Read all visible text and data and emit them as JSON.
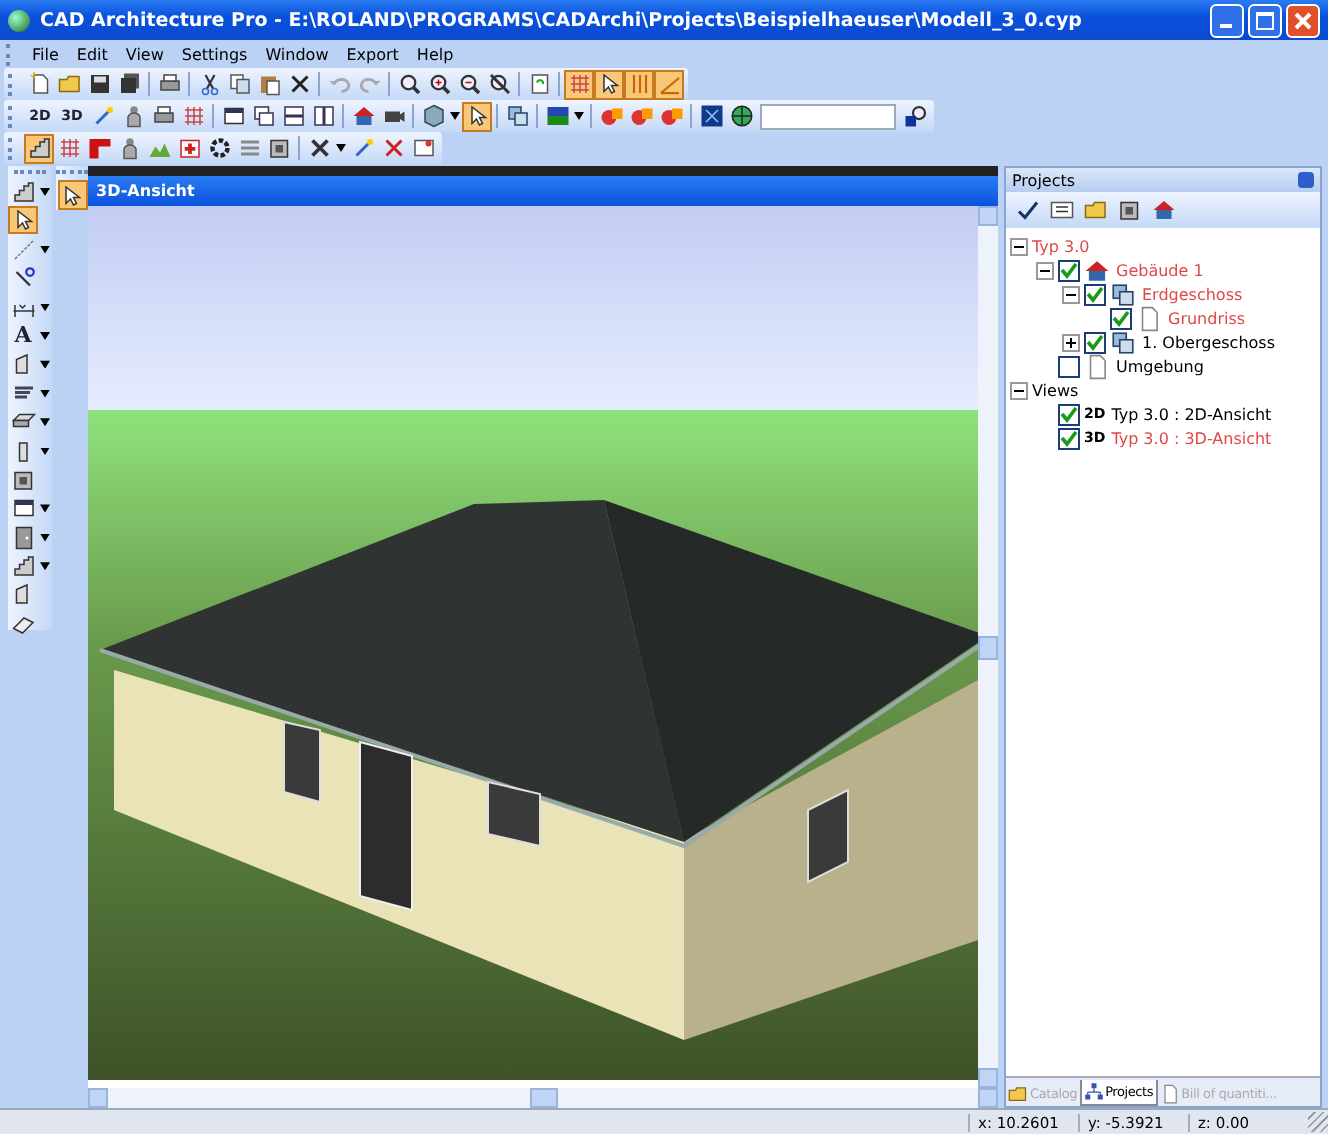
{
  "window": {
    "title": "CAD Architecture Pro - E:\\ROLAND\\PROGRAMS\\CADArchi\\Projects\\Beispielhaeuser\\Modell_3_0.cyp"
  },
  "menu": [
    "File",
    "Edit",
    "View",
    "Settings",
    "Window",
    "Export",
    "Help"
  ],
  "toolbars": [
    [
      {
        "kind": "new",
        "on": false
      },
      {
        "kind": "open",
        "on": false
      },
      {
        "kind": "save",
        "on": false
      },
      {
        "kind": "saveall",
        "on": false
      },
      {
        "kind": "sep"
      },
      {
        "kind": "print",
        "on": false
      },
      {
        "kind": "sep"
      },
      {
        "kind": "cut",
        "on": false
      },
      {
        "kind": "copy",
        "on": false
      },
      {
        "kind": "paste",
        "on": false
      },
      {
        "kind": "delete",
        "on": false
      },
      {
        "kind": "sep"
      },
      {
        "kind": "undo",
        "on": false
      },
      {
        "kind": "redo",
        "on": false
      },
      {
        "kind": "sep"
      },
      {
        "kind": "zoom",
        "on": false
      },
      {
        "kind": "zoomin",
        "on": false
      },
      {
        "kind": "zoomout",
        "on": false
      },
      {
        "kind": "zoomfit",
        "on": false
      },
      {
        "kind": "sep"
      },
      {
        "kind": "refresh",
        "on": false
      },
      {
        "kind": "sep"
      },
      {
        "kind": "grid",
        "on": true
      },
      {
        "kind": "cursor",
        "on": true
      },
      {
        "kind": "lines",
        "on": true
      },
      {
        "kind": "angle",
        "on": true
      }
    ],
    [
      {
        "kind": "text",
        "label": "2D",
        "on": false
      },
      {
        "kind": "text",
        "label": "3D",
        "on": false
      },
      {
        "kind": "wand",
        "on": false
      },
      {
        "kind": "person",
        "on": false
      },
      {
        "kind": "print",
        "on": false
      },
      {
        "kind": "grid",
        "on": false
      },
      {
        "kind": "sep"
      },
      {
        "kind": "window",
        "on": false
      },
      {
        "kind": "windows",
        "on": false
      },
      {
        "kind": "hsplit",
        "on": false
      },
      {
        "kind": "vsplit",
        "on": false
      },
      {
        "kind": "sep"
      },
      {
        "kind": "house",
        "on": false
      },
      {
        "kind": "camera",
        "on": false
      },
      {
        "kind": "sep"
      },
      {
        "kind": "cube",
        "on": false
      },
      {
        "kind": "caret"
      },
      {
        "kind": "select",
        "on": true
      },
      {
        "kind": "sep"
      },
      {
        "kind": "layers",
        "on": false
      },
      {
        "kind": "sep"
      },
      {
        "kind": "color",
        "on": false
      },
      {
        "kind": "caret"
      },
      {
        "kind": "sep"
      },
      {
        "kind": "shapes",
        "on": false
      },
      {
        "kind": "shapes",
        "on": false
      },
      {
        "kind": "shapes",
        "on": false
      },
      {
        "kind": "sep"
      },
      {
        "kind": "bluesquare",
        "on": false
      },
      {
        "kind": "globe",
        "on": false
      },
      {
        "kind": "combo"
      },
      {
        "kind": "search",
        "on": false
      }
    ],
    [
      {
        "kind": "stairs",
        "on": true
      },
      {
        "kind": "grid",
        "on": false
      },
      {
        "kind": "corner",
        "on": false
      },
      {
        "kind": "person",
        "on": false
      },
      {
        "kind": "terrain",
        "on": false
      },
      {
        "kind": "firstaid",
        "on": false
      },
      {
        "kind": "gear",
        "on": false
      },
      {
        "kind": "fence",
        "on": false
      },
      {
        "kind": "box",
        "on": false
      },
      {
        "kind": "sep"
      },
      {
        "kind": "tools",
        "on": false
      },
      {
        "kind": "caret"
      },
      {
        "kind": "wand",
        "on": false
      },
      {
        "kind": "scissors",
        "on": false
      },
      {
        "kind": "image",
        "on": false
      }
    ]
  ],
  "left_toolbar": [
    {
      "kind": "stairs",
      "on": false,
      "dropdown": true
    },
    {
      "kind": "select",
      "on": true,
      "dropdown": false
    },
    {
      "kind": "line",
      "on": false,
      "dropdown": true
    },
    {
      "kind": "measure",
      "on": false,
      "dropdown": false
    },
    {
      "kind": "dimension",
      "on": false,
      "dropdown": true
    },
    {
      "kind": "text",
      "label": "A",
      "on": false,
      "dropdown": true
    },
    {
      "kind": "wall",
      "on": false,
      "dropdown": true
    },
    {
      "kind": "ceiling",
      "on": false,
      "dropdown": true
    },
    {
      "kind": "roof",
      "on": false,
      "dropdown": true
    },
    {
      "kind": "column",
      "on": false,
      "dropdown": true
    },
    {
      "kind": "box",
      "on": false,
      "dropdown": false
    },
    {
      "kind": "window",
      "on": false,
      "dropdown": true
    },
    {
      "kind": "door",
      "on": false,
      "dropdown": true
    },
    {
      "kind": "stairs",
      "on": false,
      "dropdown": true
    },
    {
      "kind": "wall",
      "on": false,
      "dropdown": false
    },
    {
      "kind": "eraser",
      "on": false,
      "dropdown": false
    }
  ],
  "side_toolbar": [
    {
      "kind": "select",
      "on": true
    }
  ],
  "view": {
    "title": "3D-Ansicht"
  },
  "projects": {
    "title": "Projects",
    "tools": [
      {
        "kind": "check"
      },
      {
        "kind": "list"
      },
      {
        "kind": "open"
      },
      {
        "kind": "box"
      },
      {
        "kind": "house"
      }
    ],
    "tree": [
      {
        "label": "Typ 3.0",
        "color": "#e04848",
        "expanded": true,
        "children": [
          {
            "label": "Gebäude 1",
            "kind": "house",
            "checked": true,
            "color": "#e04848",
            "expanded": true,
            "children": [
              {
                "label": "Erdgeschoss",
                "kind": "layers",
                "checked": true,
                "color": "#e04848",
                "expanded": true,
                "children": [
                  {
                    "label": "Grundriss",
                    "kind": "page",
                    "checked": true,
                    "color": "#e04848"
                  }
                ]
              },
              {
                "label": "1. Obergeschoss",
                "kind": "layers",
                "checked": true,
                "color": "#000000",
                "expanded": false
              }
            ]
          },
          {
            "label": "Umgebung",
            "kind": "page",
            "checked": false,
            "color": "#000000"
          }
        ]
      },
      {
        "label": "Views",
        "color": "#000000",
        "expanded": true,
        "children": [
          {
            "label": "Typ 3.0 : 2D-Ansicht",
            "badge": "2D",
            "checked": true,
            "color": "#000000"
          },
          {
            "label": "Typ 3.0 : 3D-Ansicht",
            "badge": "3D",
            "checked": true,
            "color": "#e04848"
          }
        ]
      }
    ],
    "tabs": [
      {
        "label": "Catalog",
        "kind": "folder",
        "selected": false
      },
      {
        "label": "Projects",
        "kind": "tree",
        "selected": true
      },
      {
        "label": "Bill of quantiti...",
        "kind": "page",
        "selected": false
      }
    ]
  },
  "status_bar": [
    "x: 10.2601",
    "y: -5.3921",
    "z: 0.00"
  ]
}
